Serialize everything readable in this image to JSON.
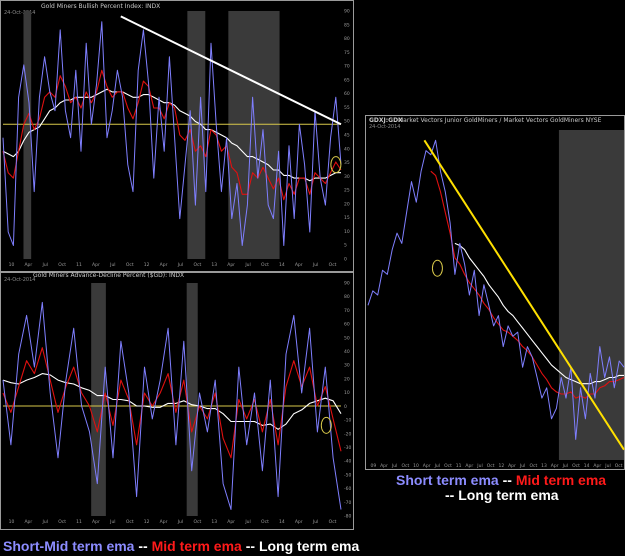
{
  "colors": {
    "short": "#7f7fff",
    "mid": "#e01010",
    "long": "#ffffff",
    "ref": "#d8c84a",
    "trend_white": "#ffffff",
    "trend_yellow": "#ffe000",
    "arrow": "#ffe800"
  },
  "legends": {
    "bottom_left": {
      "short_mid": "Short-Mid term ema",
      "sep1": " -- ",
      "mid": "Mid term ema",
      "sep2": " -- ",
      "long": "Long term ema"
    },
    "right": {
      "short": "Short term ema",
      "sep1": " -- ",
      "mid": "Mid term ema",
      "sep2": "-- ",
      "long": "Long term ema"
    }
  },
  "chart_data": [
    {
      "type": "line",
      "title": "Gold Miners Bullish Percent Index: INDX",
      "date": "24-Oct-2014",
      "x_tick_labels": [
        "10",
        "Apr",
        "Jul",
        "Oct",
        "11",
        "Apr",
        "Jul",
        "Oct",
        "12",
        "Apr",
        "Jul",
        "Oct",
        "13",
        "Apr",
        "Jul",
        "Oct",
        "14",
        "Apr",
        "Jul",
        "Oct"
      ],
      "y_tick_labels": [
        "0",
        "5",
        "10",
        "15",
        "20",
        "25",
        "30",
        "35",
        "40",
        "45",
        "50",
        "55",
        "60",
        "65",
        "70",
        "75",
        "80",
        "85",
        "90"
      ],
      "ylim": [
        0,
        92
      ],
      "reference_line": 50,
      "series": [
        {
          "key": "short",
          "values": [
            45,
            10,
            5,
            60,
            72,
            58,
            25,
            60,
            75,
            62,
            55,
            85,
            55,
            45,
            70,
            40,
            80,
            50,
            65,
            88,
            45,
            55,
            70,
            60,
            35,
            25,
            70,
            85,
            65,
            30,
            60,
            40,
            75,
            45,
            15,
            35,
            55,
            20,
            60,
            25,
            80,
            50,
            25,
            45,
            15,
            28,
            5,
            20,
            60,
            30,
            48,
            20,
            15,
            40,
            5,
            42,
            15,
            50,
            35,
            10,
            55,
            30,
            20,
            45,
            60,
            35
          ]
        },
        {
          "key": "mid",
          "values": [
            40,
            32,
            30,
            40,
            50,
            54,
            48,
            52,
            60,
            62,
            60,
            68,
            64,
            58,
            60,
            56,
            62,
            58,
            62,
            70,
            64,
            60,
            62,
            62,
            56,
            52,
            58,
            66,
            64,
            56,
            56,
            52,
            58,
            56,
            46,
            44,
            48,
            40,
            42,
            38,
            48,
            46,
            40,
            42,
            34,
            32,
            24,
            24,
            32,
            30,
            34,
            30,
            26,
            30,
            22,
            28,
            24,
            30,
            30,
            24,
            32,
            30,
            28,
            32,
            36,
            33
          ]
        },
        {
          "key": "long",
          "values": [
            40,
            39,
            38,
            40,
            44,
            47,
            48,
            49,
            52,
            55,
            56,
            58,
            59,
            59,
            60,
            60,
            60,
            60,
            61,
            62,
            63,
            62,
            62,
            62,
            61,
            60,
            60,
            61,
            61,
            60,
            59,
            58,
            58,
            57,
            55,
            54,
            53,
            51,
            50,
            48,
            48,
            47,
            46,
            45,
            43,
            42,
            40,
            38,
            38,
            37,
            36,
            35,
            33,
            33,
            31,
            31,
            30,
            30,
            30,
            29,
            30,
            30,
            30,
            31,
            32,
            32
          ]
        }
      ],
      "trend_lines": [
        {
          "color_key": "trend_white",
          "from": [
            23,
            90
          ],
          "to": [
            66,
            50
          ]
        }
      ],
      "shaded_ranges": [
        [
          4,
          5.5
        ],
        [
          36,
          39.5
        ],
        [
          44,
          54
        ]
      ],
      "arrows": [
        {
          "side": "right",
          "y": 75
        },
        {
          "side": "right",
          "y": 26
        }
      ],
      "circles": [
        {
          "x": 65,
          "y": 35
        }
      ]
    },
    {
      "type": "line",
      "title": "Gold Miners Advance-Decline Percent ($GD): INDX",
      "date": "24-Oct-2014",
      "x_tick_labels": [
        "10",
        "Apr",
        "Jul",
        "Oct",
        "11",
        "Apr",
        "Jul",
        "Oct",
        "12",
        "Apr",
        "Jul",
        "Oct",
        "13",
        "Apr",
        "Jul",
        "Oct",
        "14",
        "Apr",
        "Jul",
        "Oct"
      ],
      "y_tick_labels": [
        "-80",
        "-70",
        "-60",
        "-50",
        "-40",
        "-30",
        "-20",
        "-10",
        "0",
        "10",
        "20",
        "30",
        "40",
        "50",
        "60",
        "70",
        "80",
        "90"
      ],
      "ylim": [
        -85,
        95
      ],
      "reference_line": 0,
      "x_range": [
        22,
        68
      ],
      "series": [
        {
          "key": "short",
          "values": [
            20,
            -30,
            40,
            70,
            30,
            80,
            10,
            -40,
            20,
            60,
            0,
            -20,
            -60,
            30,
            -40,
            50,
            10,
            -70,
            30,
            -10,
            20,
            60,
            -30,
            50,
            -50,
            10,
            -20,
            20,
            -60,
            -80,
            30,
            -30,
            10,
            -50,
            20,
            -70,
            40,
            70,
            10,
            60,
            -20,
            30,
            -40,
            -80
          ]
        },
        {
          "key": "mid",
          "values": [
            10,
            -5,
            15,
            35,
            25,
            45,
            20,
            -5,
            15,
            30,
            10,
            0,
            -20,
            10,
            -15,
            20,
            5,
            -30,
            10,
            0,
            10,
            25,
            -5,
            20,
            -20,
            0,
            -10,
            10,
            -25,
            -40,
            5,
            -10,
            5,
            -20,
            5,
            -30,
            15,
            35,
            15,
            30,
            0,
            15,
            -10,
            -35
          ]
        },
        {
          "key": "long",
          "values": [
            20,
            18,
            17,
            20,
            22,
            25,
            24,
            20,
            18,
            17,
            14,
            12,
            8,
            8,
            5,
            5,
            4,
            0,
            0,
            -1,
            -1,
            2,
            2,
            4,
            1,
            0,
            -2,
            -2,
            -6,
            -12,
            -12,
            -12,
            -12,
            -15,
            -14,
            -18,
            -14,
            -6,
            -3,
            2,
            4,
            6,
            4,
            -6
          ]
        }
      ],
      "shaded_ranges": [
        [
          34,
          36
        ],
        [
          47,
          48.5
        ]
      ],
      "circles": [
        {
          "x": 66,
          "y": -15
        }
      ]
    },
    {
      "type": "line",
      "title": "GDXJ:GDX",
      "subtitle": "Market Vectors Junior GoldMiners / Market Vectors GoldMiners NYSE",
      "date": "24-Oct-2014",
      "x_tick_labels": [
        "09",
        "Apr",
        "Jul",
        "Oct",
        "10",
        "Apr",
        "Jul",
        "Oct",
        "11",
        "Apr",
        "Jul",
        "Oct",
        "12",
        "Apr",
        "Jul",
        "Oct",
        "13",
        "Apr",
        "Jul",
        "Oct",
        "14",
        "Apr",
        "Jul",
        "Oct"
      ],
      "ylim": [
        0.8,
        2.4
      ],
      "x_range": [
        13,
        72
      ],
      "series": [
        {
          "key": "short",
          "values": [
            1.55,
            1.62,
            1.6,
            1.72,
            1.7,
            1.82,
            1.9,
            1.85,
            2.0,
            2.15,
            2.05,
            2.2,
            2.3,
            2.28,
            2.35,
            2.2,
            2.1,
            1.95,
            1.7,
            1.85,
            1.75,
            1.6,
            1.72,
            1.5,
            1.65,
            1.55,
            1.45,
            1.5,
            1.35,
            1.45,
            1.4,
            1.42,
            1.25,
            1.35,
            1.3,
            1.2,
            1.1,
            1.15,
            1.0,
            1.05,
            1.2,
            1.1,
            1.25,
            0.9,
            1.15,
            1.0,
            1.22,
            1.1,
            1.35,
            1.2,
            1.3,
            1.15,
            1.28,
            1.25
          ]
        },
        {
          "key": "mid",
          "values": [
            null,
            null,
            null,
            null,
            null,
            null,
            null,
            null,
            null,
            null,
            null,
            null,
            null,
            2.2,
            2.18,
            2.1,
            2.0,
            1.9,
            1.78,
            1.75,
            1.7,
            1.66,
            1.63,
            1.6,
            1.56,
            1.53,
            1.49,
            1.46,
            1.43,
            1.42,
            1.4,
            1.38,
            1.35,
            1.33,
            1.3,
            1.26,
            1.22,
            1.19,
            1.15,
            1.13,
            1.12,
            1.12,
            1.13,
            1.1,
            1.11,
            1.1,
            1.12,
            1.12,
            1.15,
            1.16,
            1.18,
            1.18,
            1.19,
            1.2
          ]
        },
        {
          "key": "long",
          "values": [
            null,
            null,
            null,
            null,
            null,
            null,
            null,
            null,
            null,
            null,
            null,
            null,
            null,
            null,
            null,
            null,
            null,
            null,
            1.85,
            1.84,
            1.82,
            1.78,
            1.75,
            1.72,
            1.69,
            1.65,
            1.62,
            1.59,
            1.55,
            1.52,
            1.5,
            1.47,
            1.44,
            1.41,
            1.38,
            1.35,
            1.32,
            1.29,
            1.26,
            1.24,
            1.22,
            1.2,
            1.19,
            1.18,
            1.17,
            1.17,
            1.17,
            1.18,
            1.18,
            1.19,
            1.2,
            1.2,
            1.21,
            1.21
          ]
        }
      ],
      "trend_lines": [
        {
          "color_key": "trend_yellow",
          "from": [
            26,
            2.35
          ],
          "to": [
            72,
            0.85
          ]
        }
      ],
      "shaded_ranges": [
        [
          57,
          72
        ]
      ],
      "circles": [
        {
          "x": 29,
          "y": 1.73
        }
      ]
    }
  ]
}
